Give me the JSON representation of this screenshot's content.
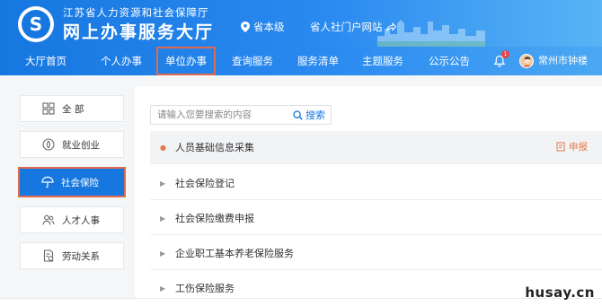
{
  "header": {
    "org_name": "江苏省人力资源和社会保障厅",
    "site_name": "网上办事服务大厅",
    "region": "省本级",
    "portal_link": "省人社门户网站"
  },
  "nav": {
    "items": [
      {
        "label": "大厅首页",
        "active": false
      },
      {
        "label": "个人办事",
        "active": false
      },
      {
        "label": "单位办事",
        "active": true
      },
      {
        "label": "查询服务",
        "active": false
      },
      {
        "label": "服务清单",
        "active": false
      },
      {
        "label": "主题服务",
        "active": false
      },
      {
        "label": "公示公告",
        "active": false
      }
    ],
    "notification_count": "1",
    "user_name": "常州市钟楼"
  },
  "sidebar": {
    "items": [
      {
        "label": "全 部",
        "icon": "grid-icon",
        "active": false
      },
      {
        "label": "就业创业",
        "icon": "leaf-icon",
        "active": false
      },
      {
        "label": "社会保险",
        "icon": "umbrella-icon",
        "active": true
      },
      {
        "label": "人才人事",
        "icon": "people-icon",
        "active": false
      },
      {
        "label": "劳动关系",
        "icon": "document-icon",
        "active": false
      }
    ]
  },
  "search": {
    "placeholder": "请输入您要搜索的内容",
    "button_label": "搜索"
  },
  "services": [
    {
      "label": "人员基础信息采集",
      "expanded": true,
      "action": "申报"
    },
    {
      "label": "社会保险登记",
      "expanded": false
    },
    {
      "label": "社会保险缴费申报",
      "expanded": false
    },
    {
      "label": "企业职工基本养老保险服务",
      "expanded": false
    },
    {
      "label": "工伤保险服务",
      "expanded": false
    }
  ],
  "watermark": "husay.cn",
  "colors": {
    "primary": "#1677e0",
    "highlight_border": "#e06a4d",
    "accent_orange": "#e07a4f"
  }
}
